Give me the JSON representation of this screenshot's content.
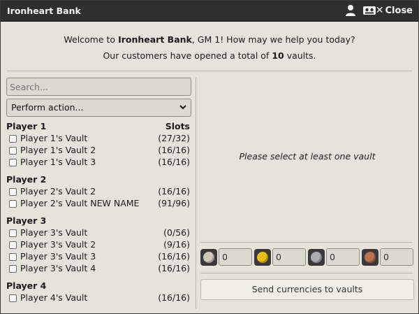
{
  "titlebar": {
    "title": "Ironheart Bank",
    "icons": [
      "user-icon",
      "players-icon"
    ],
    "close_label": "Close"
  },
  "welcome": {
    "line1_pre": "Welcome to ",
    "bank_name": "Ironheart Bank",
    "line1_post": ", GM 1! How may we help you today?",
    "line2_pre": "Our customers have opened a total of ",
    "vault_count": "10",
    "line2_post": " vaults."
  },
  "search": {
    "placeholder": "Search..."
  },
  "action_select": {
    "selected": "Perform action..."
  },
  "slots_header": "Slots",
  "groups": [
    {
      "player": "Player 1",
      "vaults": [
        {
          "name": "Player 1's Vault",
          "slots": "(27/32)"
        },
        {
          "name": "Player 1's Vault 2",
          "slots": "(16/16)"
        },
        {
          "name": "Player 1's Vault 3",
          "slots": "(16/16)"
        }
      ]
    },
    {
      "player": "Player 2",
      "vaults": [
        {
          "name": "Player 2's Vault 2",
          "slots": "(16/16)"
        },
        {
          "name": "Player 2's Vault NEW NAME",
          "slots": "(91/96)"
        }
      ]
    },
    {
      "player": "Player 3",
      "vaults": [
        {
          "name": "Player 3's Vault",
          "slots": "(0/56)"
        },
        {
          "name": "Player 3's Vault 2",
          "slots": "(9/16)"
        },
        {
          "name": "Player 3's Vault 3",
          "slots": "(16/16)"
        },
        {
          "name": "Player 3's Vault 4",
          "slots": "(16/16)"
        }
      ]
    },
    {
      "player": "Player 4",
      "vaults": [
        {
          "name": "Player 4's Vault",
          "slots": "(16/16)"
        }
      ]
    }
  ],
  "detail": {
    "placeholder": "Please select at least one vault"
  },
  "currencies": [
    {
      "icon": "platinum-coin-icon",
      "value": "0",
      "color": "#cfc8b8"
    },
    {
      "icon": "gold-coin-icon",
      "value": "0",
      "color": "#e8c21a"
    },
    {
      "icon": "silver-coin-icon",
      "value": "0",
      "color": "#a9adb3"
    },
    {
      "icon": "copper-coin-icon",
      "value": "0",
      "color": "#b8724e"
    }
  ],
  "send_button": "Send currencies to vaults"
}
